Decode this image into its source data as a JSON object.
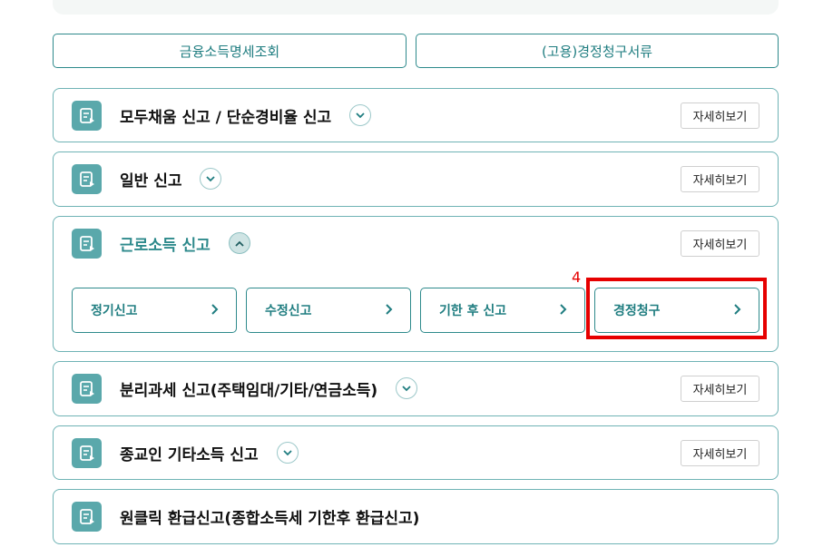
{
  "top_buttons": {
    "financial_income": "금융소득명세조회",
    "refund_docs": "(고용)경정청구서류"
  },
  "detail_label": "자세히보기",
  "cards": {
    "c1": {
      "title": "모두채움 신고 / 단순경비율 신고"
    },
    "c2": {
      "title": "일반 신고"
    },
    "c3": {
      "title": "근로소득 신고",
      "sub": {
        "regular": "정기신고",
        "amend": "수정신고",
        "late": "기한 후 신고",
        "refund": "경정청구"
      }
    },
    "c4": {
      "title": "분리과세 신고(주택임대/기타/연금소득)"
    },
    "c5": {
      "title": "종교인 기타소득 신고"
    },
    "c6": {
      "title": "원클릭 환급신고(종합소득세 기한후 환급신고)"
    }
  },
  "annotation_number": "4",
  "colors": {
    "accent": "#2e8a8c",
    "icon_bg": "#5aa8ab",
    "highlight": "#e60000"
  },
  "icons": [
    "document-icon",
    "chevron-down-icon",
    "chevron-up-icon",
    "chevron-right-icon"
  ]
}
